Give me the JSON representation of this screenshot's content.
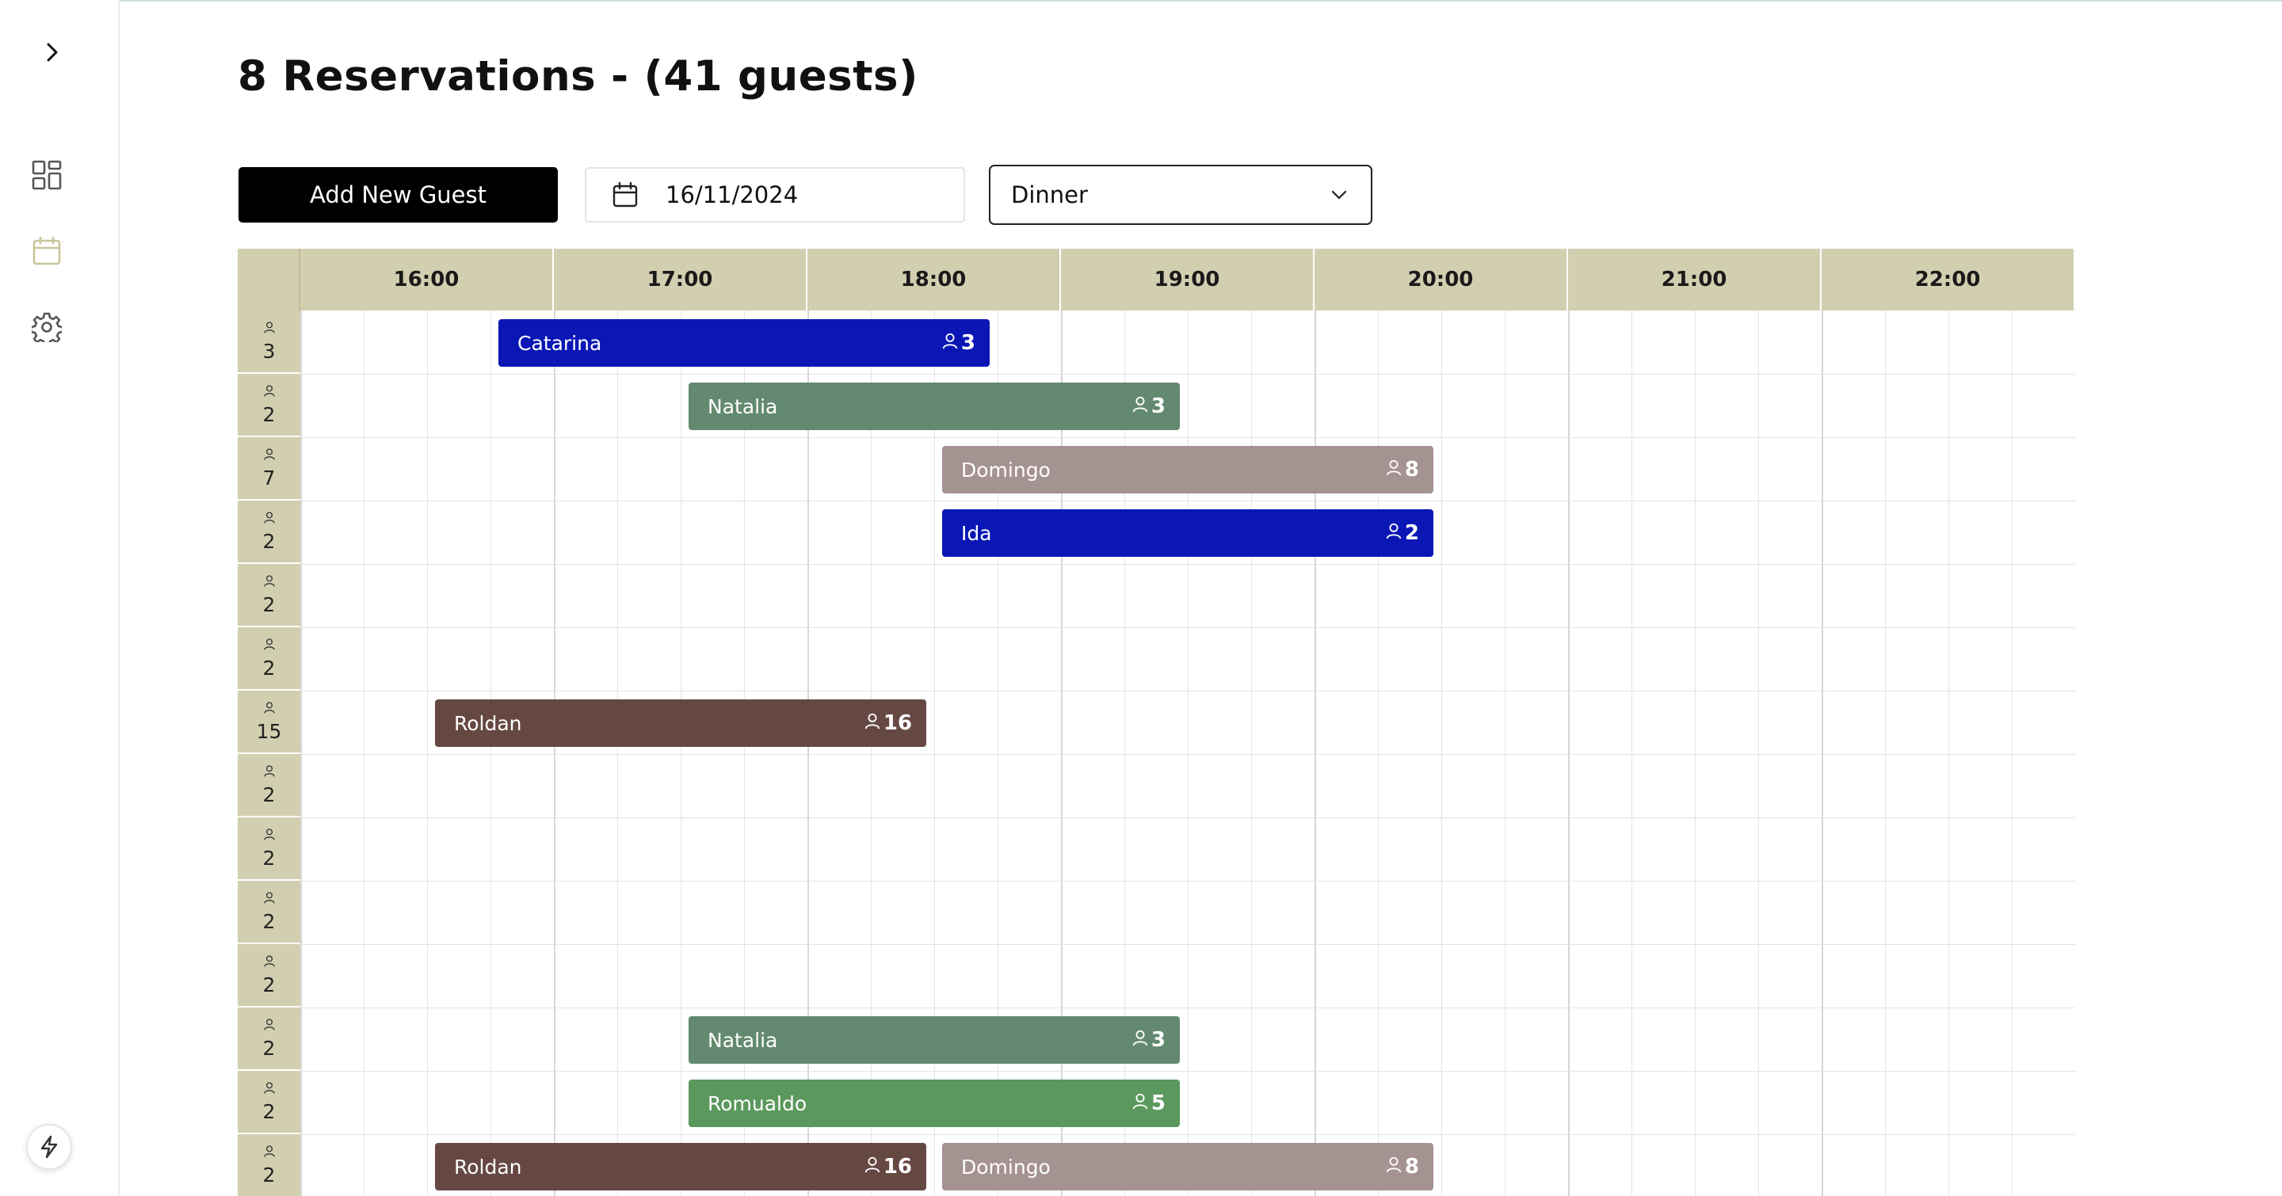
{
  "page": {
    "title": "8 Reservations - (41 guests)"
  },
  "toolbar": {
    "add_label": "Add New Guest",
    "date_value": "16/11/2024",
    "service_value": "Dinner"
  },
  "sidebar": {
    "icons": [
      "chevron-right-icon",
      "dashboard-icon",
      "calendar-icon",
      "settings-icon",
      "bolt-icon"
    ]
  },
  "colors": {
    "header_bg": "#d2ceb0",
    "blue": "#0a17b5",
    "sage": "#638a70",
    "mauve": "#a59391",
    "brown": "#664843",
    "green": "#5b985d",
    "sidebar_active": "#c8c59a"
  },
  "timeline": {
    "hours": [
      "16:00",
      "17:00",
      "18:00",
      "19:00",
      "20:00",
      "21:00",
      "22:00"
    ],
    "tables": [
      {
        "capacity": "3"
      },
      {
        "capacity": "2"
      },
      {
        "capacity": "7"
      },
      {
        "capacity": "2"
      },
      {
        "capacity": "2"
      },
      {
        "capacity": "2"
      },
      {
        "capacity": "15"
      },
      {
        "capacity": "2"
      },
      {
        "capacity": "2"
      },
      {
        "capacity": "2"
      },
      {
        "capacity": "2"
      },
      {
        "capacity": "2"
      },
      {
        "capacity": "2"
      },
      {
        "capacity": "2"
      }
    ],
    "reservations": [
      {
        "name": "Catarina",
        "guests": "3",
        "row": 0,
        "start": "16:00",
        "end": "18:00",
        "color": "#0a17b5"
      },
      {
        "name": "Natalia",
        "guests": "3",
        "row": 1,
        "start": "16:45",
        "end": "18:45",
        "color": "#638a70"
      },
      {
        "name": "Domingo",
        "guests": "8",
        "row": 2,
        "start": "17:45",
        "end": "19:45",
        "color": "#a59391"
      },
      {
        "name": "Ida",
        "guests": "2",
        "row": 3,
        "start": "17:45",
        "end": "19:45",
        "color": "#0a17b5"
      },
      {
        "name": "Roldan",
        "guests": "16",
        "row": 6,
        "start": "15:45",
        "end": "17:45",
        "color": "#664843"
      },
      {
        "name": "Natalia",
        "guests": "3",
        "row": 11,
        "start": "16:45",
        "end": "18:45",
        "color": "#638a70"
      },
      {
        "name": "Romualdo",
        "guests": "5",
        "row": 12,
        "start": "16:45",
        "end": "18:45",
        "color": "#5b985d"
      },
      {
        "name": "Roldan",
        "guests": "16",
        "row": 13,
        "start": "15:45",
        "end": "17:45",
        "color": "#664843"
      },
      {
        "name": "Domingo",
        "guests": "8",
        "row": 13,
        "start": "17:45",
        "end": "19:45",
        "color": "#a59391"
      }
    ]
  }
}
